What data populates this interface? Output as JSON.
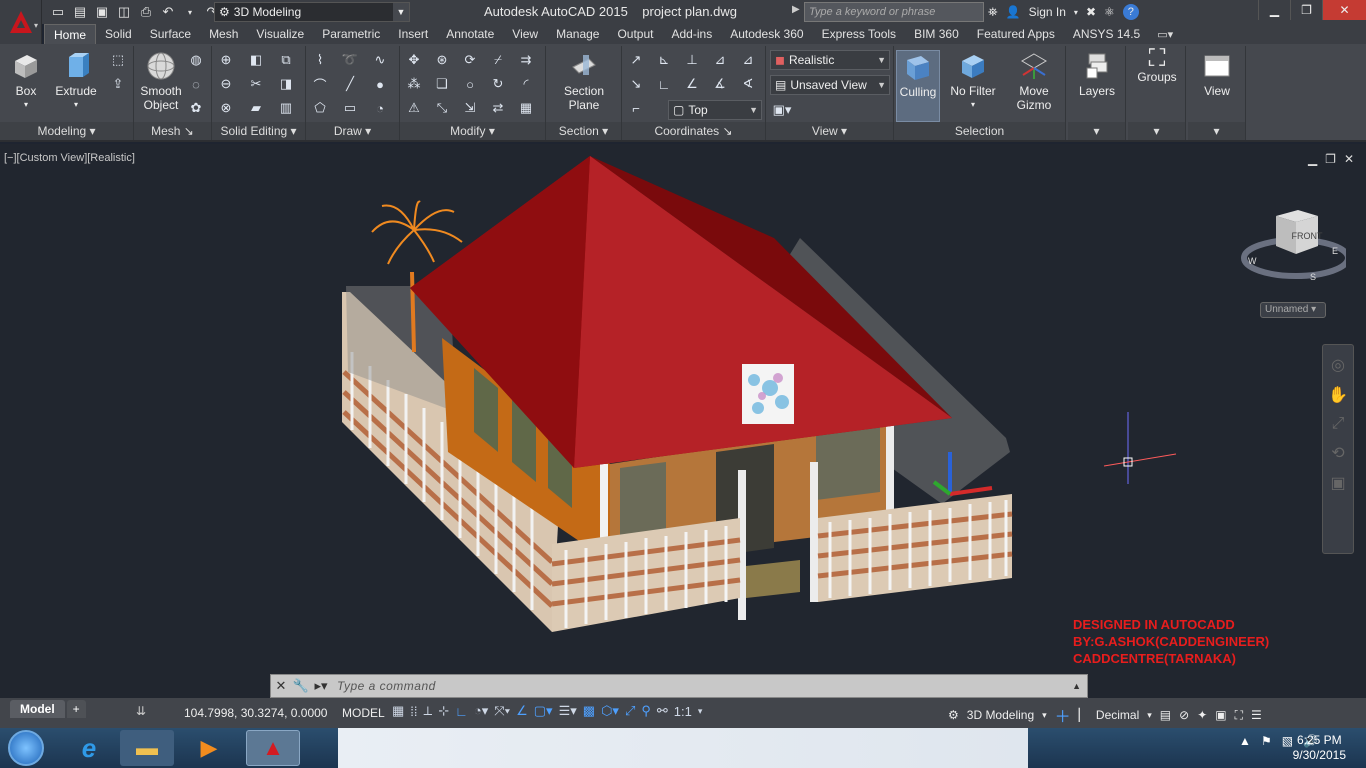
{
  "titlebar": {
    "workspace": "3D Modeling",
    "title": "Autodesk AutoCAD 2015    project plan.dwg",
    "search_placeholder": "Type a keyword or phrase",
    "sign_in": "Sign In"
  },
  "tabs": [
    "Home",
    "Solid",
    "Surface",
    "Mesh",
    "Visualize",
    "Parametric",
    "Insert",
    "Annotate",
    "View",
    "Manage",
    "Output",
    "Add-ins",
    "Autodesk 360",
    "Express Tools",
    "BIM 360",
    "Featured Apps",
    "ANSYS 14.5"
  ],
  "ribbon": {
    "modeling": {
      "title": "Modeling",
      "box": "Box",
      "extrude": "Extrude"
    },
    "mesh": {
      "title": "Mesh",
      "smooth_object": "Smooth Object"
    },
    "solid_editing": {
      "title": "Solid Editing"
    },
    "draw": {
      "title": "Draw"
    },
    "modify": {
      "title": "Modify"
    },
    "section": {
      "title": "Section",
      "section_plane": "Section Plane"
    },
    "coordinates": {
      "title": "Coordinates"
    },
    "view": {
      "title": "View",
      "visual_style": "Realistic",
      "saved_view": "Unsaved View",
      "view_dir": "Top"
    },
    "selection": {
      "title": "Selection",
      "culling": "Culling",
      "no_filter": "No Filter",
      "move_gizmo": "Move Gizmo"
    },
    "layers": "Layers",
    "groups": "Groups",
    "view_btn": "View"
  },
  "viewport": {
    "label": "[−][Custom View][Realistic]",
    "viewcube_face": "FRONT",
    "compass": {
      "n": "N",
      "e": "E",
      "s": "S",
      "w": "W"
    },
    "ucs_name": "Unnamed",
    "credits": [
      "DESIGNED IN AUTOCADD",
      "BY:G.ASHOK(CADDENGINEER)",
      "CADDCENTRE(TARNAKA)"
    ],
    "command_placeholder": "Type a command"
  },
  "statusbar": {
    "layout_model": "Model",
    "layout_add": "+",
    "coordinates": "104.7998, 30.3274, 0.0000",
    "mode": "MODEL",
    "scale": "1:1",
    "workspace": "3D Modeling",
    "units": "Decimal"
  },
  "taskbar": {
    "time": "6:25 PM",
    "date": "9/30/2015"
  },
  "colors": {
    "roof": "#8b0d0d",
    "accent": "#c8161d",
    "credit": "#e81d1d"
  }
}
